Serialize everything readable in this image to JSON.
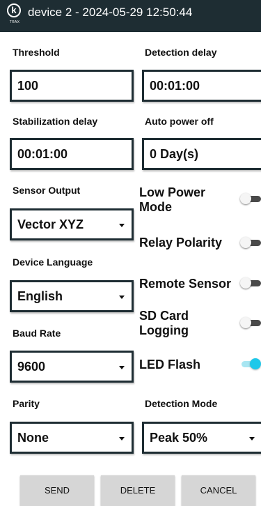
{
  "header": {
    "logo_letter": "k",
    "logo_text": "TRAX",
    "title": "device 2 - 2024-05-29 12:50:44",
    "bg_color": "#1e2d33"
  },
  "fields": {
    "threshold": {
      "label": "Threshold",
      "value": "100"
    },
    "detection_delay": {
      "label": "Detection delay",
      "value": "00:01:00"
    },
    "stabilization_delay": {
      "label": "Stabilization delay",
      "value": "00:01:00"
    },
    "auto_power_off": {
      "label": "Auto power off",
      "value": "0 Day(s)"
    },
    "sensor_output": {
      "label": "Sensor Output",
      "value": "Vector XYZ"
    },
    "device_language": {
      "label": "Device Language",
      "value": "English"
    },
    "baud_rate": {
      "label": "Baud Rate",
      "value": "9600"
    },
    "parity": {
      "label": "Parity",
      "value": "None"
    },
    "detection_mode": {
      "label": "Detection Mode",
      "value": "Peak 50%"
    }
  },
  "toggles": {
    "low_power_mode": {
      "label": "Low Power Mode",
      "on": false
    },
    "relay_polarity": {
      "label": "Relay Polarity",
      "on": false
    },
    "remote_sensor": {
      "label": "Remote Sensor",
      "on": false
    },
    "sd_card_logging": {
      "label": "SD Card Logging",
      "on": false
    },
    "led_flash": {
      "label": "LED Flash",
      "on": true
    }
  },
  "buttons": {
    "send": "SEND",
    "delete": "DELETE",
    "cancel": "CANCEL"
  },
  "colors": {
    "toggle_on": "#1ec8ea",
    "border": "#1e2d33"
  }
}
